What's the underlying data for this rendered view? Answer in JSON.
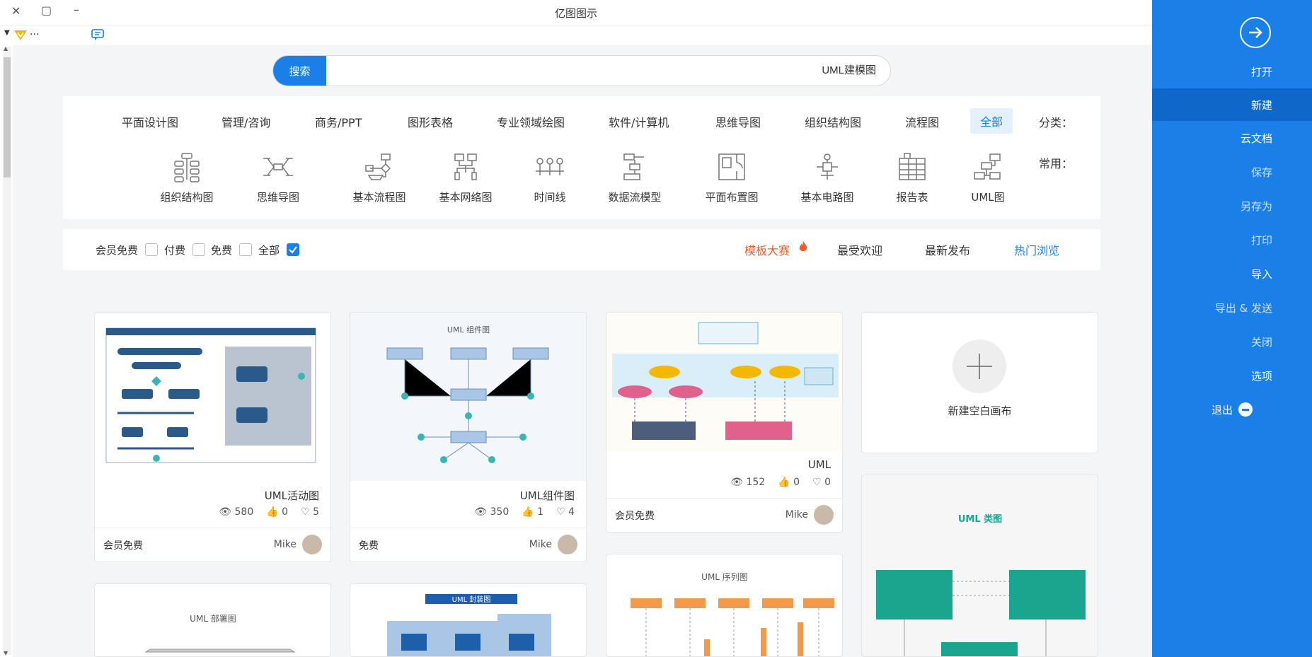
{
  "window": {
    "title": "亿图图示"
  },
  "sidebar": {
    "items": [
      {
        "label": "打开",
        "state": "normal"
      },
      {
        "label": "新建",
        "state": "active"
      },
      {
        "label": "云文档",
        "state": "normal"
      },
      {
        "label": "保存",
        "state": "muted"
      },
      {
        "label": "另存为",
        "state": "muted"
      },
      {
        "label": "打印",
        "state": "muted"
      },
      {
        "label": "导入",
        "state": "normal"
      },
      {
        "label": "导出 & 发送",
        "state": "muted"
      },
      {
        "label": "关闭",
        "state": "muted"
      },
      {
        "label": "选项",
        "state": "normal"
      },
      {
        "label": "退出",
        "state": "normal"
      }
    ]
  },
  "toolbar": {
    "more": "..."
  },
  "search": {
    "button": "搜索",
    "value": "UML建模图"
  },
  "categories": {
    "label": "分类：",
    "items": [
      "全部",
      "流程图",
      "组织结构图",
      "思维导图",
      "软件/计算机",
      "专业领域绘图",
      "图形表格",
      "商务/PPT",
      "管理/咨询",
      "平面设计图"
    ],
    "active": "全部"
  },
  "common": {
    "label": "常用：",
    "items": [
      "UML图",
      "报告表",
      "基本电路图",
      "平面布置图",
      "数据流模型",
      "时间线",
      "基本网络图",
      "基本流程图",
      "思维导图",
      "组织结构图"
    ]
  },
  "sort_tabs": {
    "hot": "热门浏览",
    "latest": "最新发布",
    "popular": "最受欢迎",
    "contest": "模板大赛"
  },
  "price_filter": {
    "all": "全部",
    "free": "免费",
    "paid": "付费",
    "member": "会员免费"
  },
  "colors": {
    "accent": "#1a7fe6",
    "contest": "#f05a28"
  },
  "new_canvas": {
    "label": "新建空白画布"
  },
  "cards": [
    {
      "title": "UML活动图",
      "views": "580",
      "likes": "0",
      "favorites": "5",
      "author": "Mike",
      "price": "会员免费"
    },
    {
      "title": "UML组件图",
      "views": "350",
      "likes": "1",
      "favorites": "4",
      "author": "Mike",
      "price": "免费"
    },
    {
      "title": "UML",
      "views": "152",
      "likes": "0",
      "favorites": "0",
      "author": "Mike",
      "price": "会员免费"
    }
  ],
  "thumbs": {
    "component_title": "UML 组件图",
    "sequence_title": "UML 序列图",
    "class_title": "UML 类图",
    "deploy_title": "UML 部署图",
    "package_title": "UML 封装图"
  }
}
